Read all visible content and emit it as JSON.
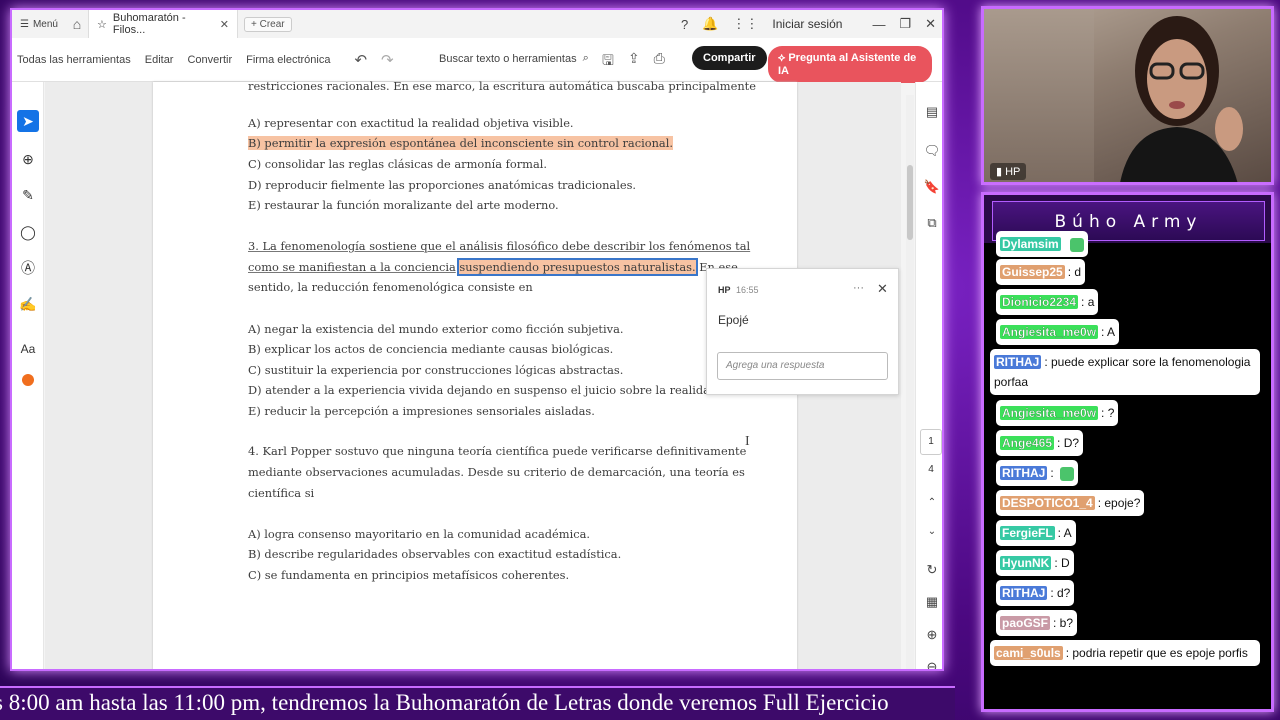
{
  "titlebar": {
    "menu_label": "Menú",
    "tab_title": "Buhomaratón - Filos...",
    "new_tab_label": "Crear",
    "signin_label": "Iniciar sesión"
  },
  "toolbar": {
    "all_tools": "Todas las herramientas",
    "edit": "Editar",
    "convert": "Convertir",
    "esign": "Firma electrónica",
    "search_label": "Buscar texto o herramientas",
    "share_label": "Compartir",
    "ai_label": "Pregunta al Asistente de IA"
  },
  "document": {
    "line_top": "restricciones racionales. En ese marco, la escritura automática buscaba principalmente",
    "q2_options": [
      "A) representar con exactitud la realidad objetiva visible.",
      "B) permitir la expresión espontánea del inconsciente sin control racional.",
      "C) consolidar las reglas clásicas de armonía formal.",
      "D) reproducir fielmente las proporciones anatómicas tradicionales.",
      "E) restaurar la función moralizante del arte moderno."
    ],
    "q3_line1": "3. La fenomenología sostiene que el análisis filosófico debe describir los fenómenos tal",
    "q3_line2_a": "como se manifiestan a la conciencia",
    "q3_line2_highlight": "suspendiendo presupuestos naturalistas.",
    "q3_line2_b": "En ese",
    "q3_line3": "sentido, la reducción fenomenológica consiste en",
    "q3_options": [
      "A) negar la existencia del mundo exterior como ficción subjetiva.",
      "B) explicar los actos de conciencia mediante causas biológicas.",
      "C) sustituir la experiencia por construcciones lógicas abstractas.",
      "D) atender a la experiencia vivida dejando en suspenso el juicio sobre la realidad.",
      "E) reducir la percepción a impresiones sensoriales aisladas."
    ],
    "q4_lines": [
      "4. Karl Popper sostuvo que ninguna teoría científica puede verificarse definitivamente",
      "mediante observaciones acumuladas. Desde su criterio de demarcación, una teoría es",
      "científica si"
    ],
    "q4_options": [
      "A) logra consenso mayoritario en la comunidad académica.",
      "B) describe regularidades observables con exactitud estadística.",
      "C) se fundamenta en principios metafísicos coherentes."
    ]
  },
  "comment": {
    "author": "HP",
    "time": "16:55",
    "text": "Epojé",
    "reply_placeholder": "Agrega una respuesta"
  },
  "pager": {
    "current": "1",
    "total": "4"
  },
  "webcam": {
    "label": "HP"
  },
  "chat": {
    "title": "Búho Army",
    "messages": [
      {
        "user": "Dylamsim",
        "text": "",
        "color": "teal",
        "emote": true
      },
      {
        "user": "Guissep25",
        "text": ": d",
        "color": "orange"
      },
      {
        "user": "Dionicio2234",
        "text": ": a",
        "color": "green"
      },
      {
        "user": "Angiesita_me0w",
        "text": ": A",
        "color": "green"
      },
      {
        "user": "RITHAJ",
        "text": ": puede explicar sore la fenomenologia porfaa",
        "color": "blue"
      },
      {
        "user": "Angiesita_me0w",
        "text": ": ?",
        "color": "green"
      },
      {
        "user": "Ange465",
        "text": ": D?",
        "color": "green"
      },
      {
        "user": "RITHAJ",
        "text": ":",
        "color": "blue",
        "emote": true
      },
      {
        "user": "DESPOTICO1_4",
        "text": ": epoje?",
        "color": "orange"
      },
      {
        "user": "FergieFL",
        "text": ": A",
        "color": "teal"
      },
      {
        "user": "HyunNK",
        "text": ": D",
        "color": "teal"
      },
      {
        "user": "RITHAJ",
        "text": ": d?",
        "color": "blue"
      },
      {
        "user": "paoGSF",
        "text": ": b?",
        "color": "pink"
      },
      {
        "user": "cami_s0uls",
        "text": ": podria repetir que es epoje porfis",
        "color": "orange"
      }
    ]
  },
  "ticker": {
    "text": "s 8:00 am hasta las 11:00 pm, tendremos la Buhomaratón de Letras donde veremos Full Ejercicio"
  }
}
